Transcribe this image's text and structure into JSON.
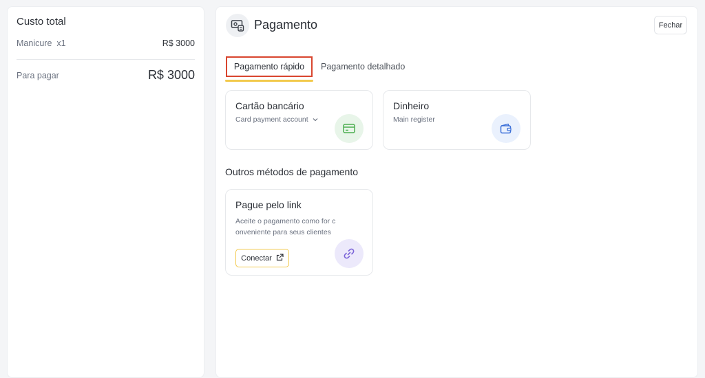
{
  "summary": {
    "title": "Custo total",
    "item_name": "Manicure  x1",
    "item_price": "R$ 3000",
    "to_pay_label": "Para pagar",
    "to_pay_amount": "R$ 3000"
  },
  "header": {
    "title": "Pagamento",
    "icon": "cash-register-icon",
    "close_label": "Fechar"
  },
  "tabs": [
    {
      "label": "Pagamento rápido",
      "active": true
    },
    {
      "label": "Pagamento detalhado",
      "active": false
    }
  ],
  "quick_methods": [
    {
      "title": "Cartão bancário",
      "subtitle": "Card payment account",
      "icon": "credit-card-icon",
      "accent": "#e8f5e9",
      "icon_color": "#4caf50"
    },
    {
      "title": "Dinheiro",
      "subtitle": "Main register",
      "icon": "wallet-icon",
      "accent": "#eaf1fd",
      "icon_color": "#3b6fd8"
    }
  ],
  "other_methods": {
    "title": "Outros métodos de pagamento",
    "link_card": {
      "title": "Pague pelo link",
      "description": "Aceite o pagamento como for conveniente para seus clientes",
      "button_label": "Conectar",
      "icon": "link-icon",
      "accent": "#ece9fb",
      "icon_color": "#7a63d8"
    }
  },
  "colors": {
    "tab_active_border": "#d9452e",
    "tab_underline": "#f2c94c",
    "connect_border": "#f2c94c"
  }
}
